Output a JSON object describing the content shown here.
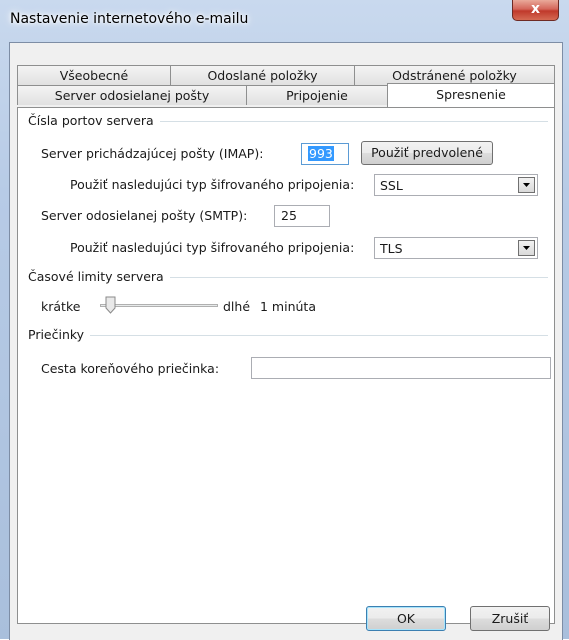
{
  "window": {
    "title": "Nastavenie internetového e-mailu",
    "close_label": "x"
  },
  "tabs_back": [
    {
      "label": "Všeobecné"
    },
    {
      "label": "Odoslané položky"
    },
    {
      "label": "Odstránené položky"
    }
  ],
  "tabs_front": [
    {
      "label": "Server odosielanej pošty"
    },
    {
      "label": "Pripojenie"
    },
    {
      "label": "Spresnenie"
    }
  ],
  "active_tab": "Spresnenie",
  "ports": {
    "group_label": "Čísla portov servera",
    "incoming_label": "Server prichádzajúcej pošty (IMAP):",
    "incoming_value": "993",
    "use_default_label": "Použiť predvolené",
    "incoming_enc_label": "Použiť nasledujúci typ šifrovaného pripojenia:",
    "incoming_enc_value": "SSL",
    "outgoing_label": "Server odosielanej pošty (SMTP):",
    "outgoing_value": "25",
    "outgoing_enc_label": "Použiť nasledujúci typ šifrovaného pripojenia:",
    "outgoing_enc_value": "TLS"
  },
  "timeouts": {
    "group_label": "Časové limity servera",
    "short_label": "krátke",
    "long_label": "dlhé",
    "value_label": "1 minúta",
    "slider_level": 0.05
  },
  "folders": {
    "group_label": "Priečinky",
    "root_path_label": "Cesta koreňového priečinka:",
    "root_path_value": ""
  },
  "buttons": {
    "ok": "OK",
    "cancel": "Zrušiť"
  }
}
